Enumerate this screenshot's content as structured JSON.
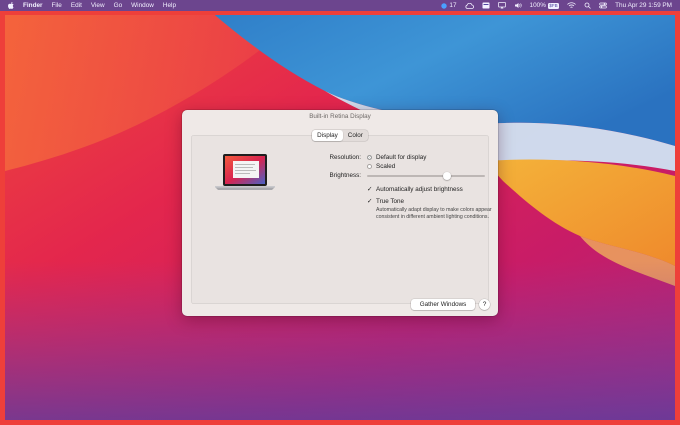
{
  "menubar": {
    "apple_icon": "apple-logo-icon",
    "app_name": "Finder",
    "menus": [
      "File",
      "Edit",
      "View",
      "Go",
      "Window",
      "Help"
    ],
    "status_badge": "17",
    "battery_percent": "100%",
    "battery_badge": "$FB",
    "datetime": "Thu Apr 29  1:59 PM"
  },
  "dialog": {
    "title": "Built-in Retina Display",
    "tabs": [
      {
        "label": "Display",
        "active": true
      },
      {
        "label": "Color",
        "active": false
      }
    ],
    "resolution": {
      "label": "Resolution:",
      "options": [
        {
          "label": "Default for display",
          "selected": true
        },
        {
          "label": "Scaled",
          "selected": false
        }
      ]
    },
    "brightness": {
      "label": "Brightness:",
      "level": 0.68
    },
    "auto_brightness": {
      "label": "Automatically adjust brightness",
      "checked": true
    },
    "true_tone": {
      "label": "True Tone",
      "checked": true,
      "description": "Automatically adapt display to make colors appear consistent in different ambient lighting conditions."
    },
    "gather_button": "Gather Windows",
    "help_button": "?"
  },
  "colors": {
    "menubar": "#5046a0",
    "dialog_bg": "#efe9e7",
    "screen_border": "#ee3f3a"
  }
}
